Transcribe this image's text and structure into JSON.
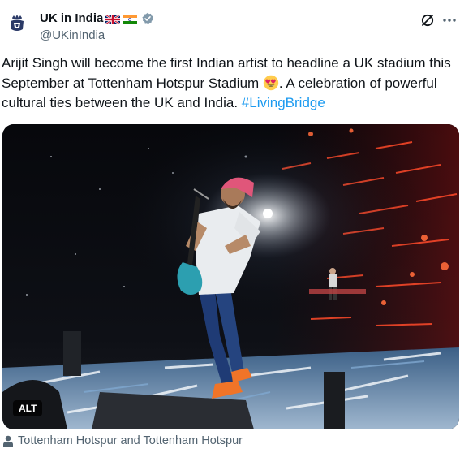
{
  "account": {
    "name": "UK in India",
    "handle": "@UKinIndia",
    "verified": true,
    "avatar_icon": "royal-crest-icon",
    "flags": [
      "uk-flag-icon",
      "india-flag-icon"
    ]
  },
  "tweet": {
    "text_before_emoji": "Arijit Singh will become the first Indian artist to headline a UK stadium this September at Tottenham Hotspur Stadium ",
    "emoji": "heart-eyes-emoji",
    "text_after_emoji": ". A celebration of powerful cultural ties between the UK and India. ",
    "hashtag": "#LivingBridge"
  },
  "media": {
    "alt_label": "ALT",
    "description_icon": "concert-photo"
  },
  "tagged": {
    "icon": "person-icon",
    "text": "Tottenham Hotspur and Tottenham Hotspur"
  },
  "colors": {
    "text": "#0f1419",
    "secondary": "#536471",
    "link": "#1d9bf0",
    "verified": "#829aab"
  }
}
